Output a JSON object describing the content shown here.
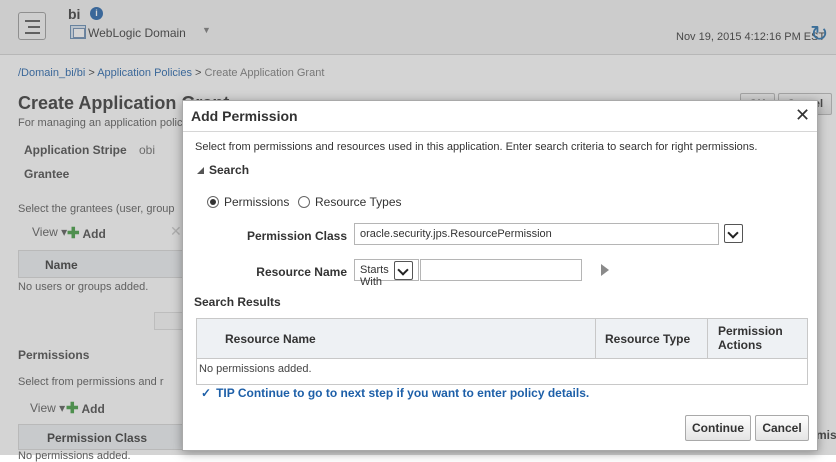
{
  "header": {
    "app_name": "bi",
    "info_badge": "i",
    "domain_label": "WebLogic Domain",
    "domain_caret": "▼",
    "timestamp": "Nov 19, 2015 4:12:16 PM EST",
    "refresh_glyph": "↻"
  },
  "breadcrumb": {
    "link1": "/Domain_bi/bi",
    "sep1": " > ",
    "link2": "Application Policies",
    "sep2": " > ",
    "current": "Create Application Grant"
  },
  "page": {
    "title": "Create Application Grant",
    "description": "For managing an application policy",
    "ok_label": "OK",
    "cancel_label": "Cancel",
    "stripe_label": "Application Stripe",
    "stripe_value": "obi",
    "grantee_heading": "Grantee",
    "grantee_desc": "Select the grantees (user, group",
    "view_label": "View ▾",
    "add_label": "Add",
    "add_plus": "✚",
    "delete_glyph": "✕",
    "name_col": "Name",
    "no_users": "No users or groups added.",
    "permissions_heading": "Permissions",
    "permissions_desc": "Select from permissions and r",
    "permission_class_col": "Permission Class",
    "no_permissions": "No permissions added.",
    "right_cut_text": "mis"
  },
  "dialog": {
    "title": "Add Permission",
    "close_glyph": "✕",
    "description": "Select from permissions and resources used in this application. Enter search criteria to search for right permissions.",
    "search_heading": "Search",
    "radio_permissions": "Permissions",
    "radio_resource_types": "Resource Types",
    "permission_class_label": "Permission Class",
    "permission_class_value": "oracle.security.jps.ResourcePermission",
    "resource_name_label": "Resource Name",
    "resource_name_operator": "Starts With",
    "resource_name_value": "",
    "results_heading": "Search Results",
    "columns": {
      "resource_name": "Resource Name",
      "resource_type": "Resource Type",
      "permission_actions_line1": "Permission",
      "permission_actions_line2": "Actions"
    },
    "empty_text": "No permissions added.",
    "tip_icon": "✓",
    "tip_text": "TIP Continue to go to next step if you want to enter policy details.",
    "continue_label": "Continue",
    "cancel_label": "Cancel"
  },
  "colors": {
    "link_blue": "#1d5fa8",
    "header_bg": "#f3f3f3",
    "table_header_bg": "#eef1f4",
    "add_green": "#3a9a3a"
  }
}
